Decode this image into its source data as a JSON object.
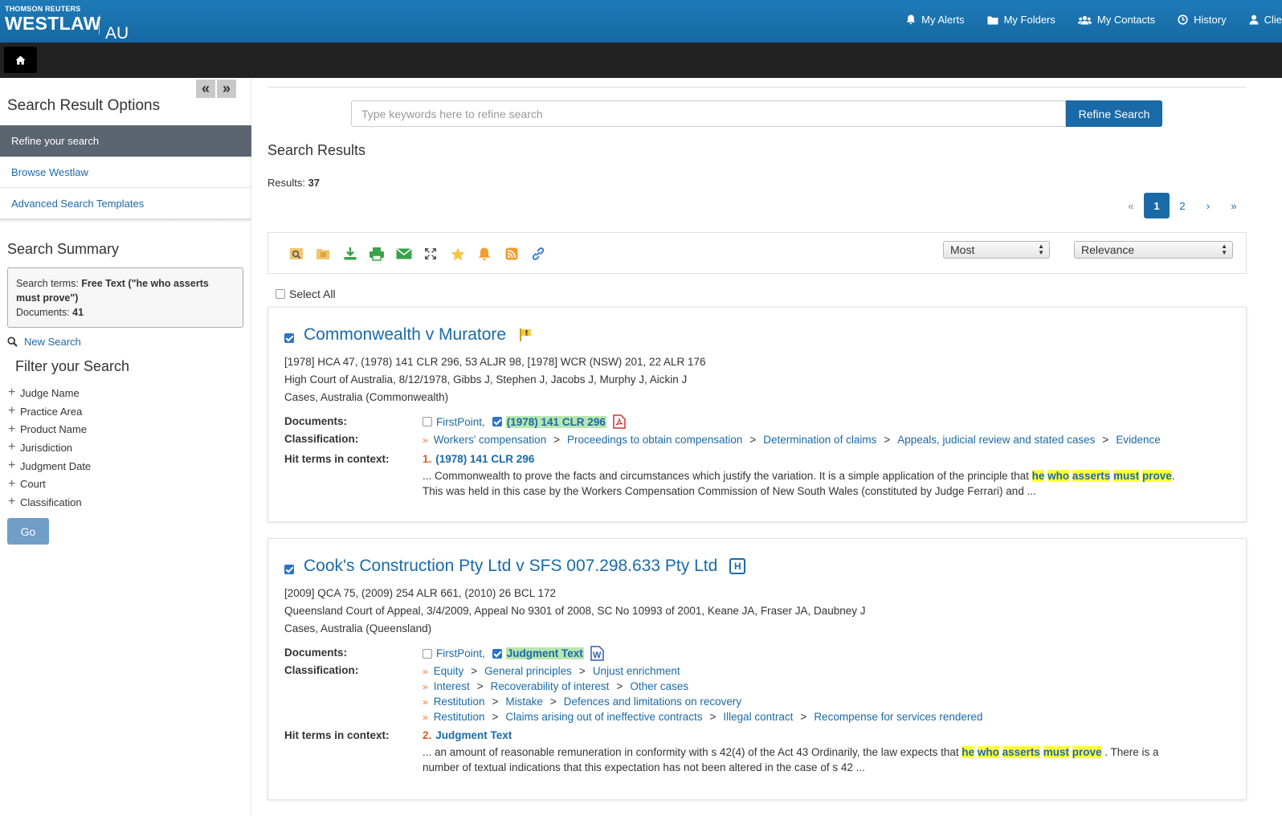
{
  "header": {
    "brand_small": "THOMSON REUTERS",
    "brand_main": "WESTLAW",
    "brand_region": "AU",
    "nav": [
      {
        "label": "My Alerts",
        "icon": "bell-icon"
      },
      {
        "label": "My Folders",
        "icon": "folder-icon"
      },
      {
        "label": "My Contacts",
        "icon": "contacts-icon"
      },
      {
        "label": "History",
        "icon": "clock-icon"
      },
      {
        "label": "Clie",
        "icon": "user-icon"
      }
    ]
  },
  "sidebar": {
    "title": "Search Result Options",
    "menu": [
      "Refine your search",
      "Browse Westlaw",
      "Advanced Search Templates"
    ],
    "summary_title": "Search Summary",
    "summary": {
      "terms_label": "Search terms: ",
      "terms_value": "Free Text (\"he who asserts must prove\")",
      "docs_label": "Documents: ",
      "docs_value": "41"
    },
    "new_search": "New Search",
    "filter_title": "Filter your Search",
    "filters": [
      "Judge Name",
      "Practice Area",
      "Product Name",
      "Jurisdiction",
      "Judgment Date",
      "Court",
      "Classification"
    ],
    "go_label": "Go"
  },
  "main": {
    "search_placeholder": "Type keywords here to refine search",
    "refine_label": "Refine Search",
    "title": "Search Results",
    "results_label": "Results: ",
    "results_count": "37",
    "pager": [
      "«",
      "1",
      "2",
      "›",
      "»"
    ],
    "select_most": "Most",
    "select_sort": "Relevance",
    "select_all": "Select All"
  },
  "results": [
    {
      "title": "Commonwealth v Muratore",
      "citation": "[1978] HCA 47, (1978) 141 CLR 296, 53 ALJR 98, [1978] WCR (NSW) 201, 22 ALR 176",
      "court": "High Court of Australia, 8/12/1978, Gibbs J, Stephen J, Jacobs J, Murphy J, Aickin J",
      "type": "Cases, Australia (Commonwealth)",
      "documents_label": "Documents:",
      "doc_firstpoint": "FirstPoint,",
      "doc_main": "(1978) 141 CLR 296",
      "classification_label": "Classification:",
      "classification": [
        [
          "Workers' compensation",
          "Proceedings to obtain compensation",
          "Determination of claims",
          "Appeals, judicial review and stated cases",
          "Evidence"
        ]
      ],
      "hits_label": "Hit terms in context:",
      "hit_num": "1.",
      "hit_title": "(1978) 141 CLR 296",
      "snippet_pre": "... Commonwealth to prove the facts and circumstances which justify the variation. It is a simple application of the principle that ",
      "snippet_terms": [
        "he",
        "who",
        "asserts",
        "must",
        "prove"
      ],
      "snippet_after_terms": ".",
      "snippet_line2": "This was held in this case by the Workers Compensation Commission of New South Wales (constituted by Judge Ferrari) and ..."
    },
    {
      "title": "Cook's Construction Pty Ltd v SFS 007.298.633 Pty Ltd",
      "badge": "H",
      "citation": "[2009] QCA 75, (2009) 254 ALR 661, (2010) 26 BCL 172",
      "court": "Queensland Court of Appeal, 3/4/2009, Appeal No 9301 of 2008, SC No 10993 of 2001, Keane JA, Fraser JA, Daubney J",
      "type": "Cases, Australia (Queensland)",
      "documents_label": "Documents:",
      "doc_firstpoint": "FirstPoint,",
      "doc_main": "Judgment Text",
      "classification_label": "Classification:",
      "classification": [
        [
          "Equity",
          "General principles",
          "Unjust enrichment"
        ],
        [
          "Interest",
          "Recoverability of interest",
          "Other cases"
        ],
        [
          "Restitution",
          "Mistake",
          "Defences and limitations on recovery"
        ],
        [
          "Restitution",
          "Claims arising out of ineffective contracts",
          "Illegal contract",
          "Recompense for services rendered"
        ]
      ],
      "hits_label": "Hit terms in context:",
      "hit_num": "2.",
      "hit_title": "Judgment Text",
      "snippet_pre": "... an amount of reasonable remuneration in conformity with s 42(4) of the Act 43 Ordinarily, the law expects that ",
      "snippet_terms": [
        "he",
        "who",
        "asserts",
        "must",
        "prove"
      ],
      "snippet_after_terms": " . There is a",
      "snippet_line2": "number of textual indications that this expectation has not been altered in the case of s 42 ..."
    }
  ]
}
